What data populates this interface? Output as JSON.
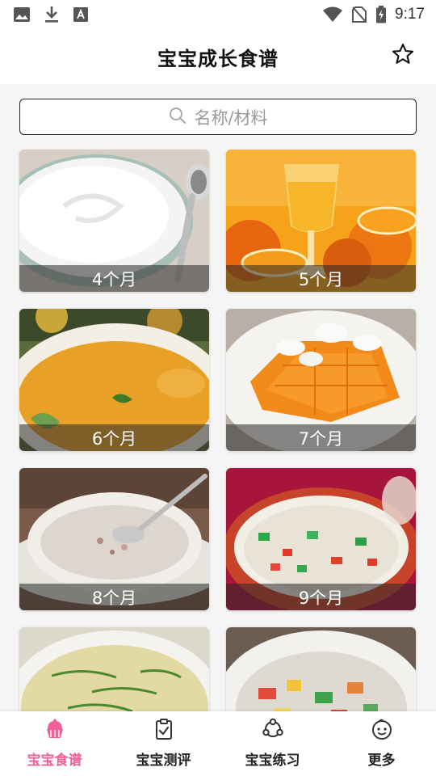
{
  "status_bar": {
    "time": "9:17",
    "left_icons": [
      "image-icon",
      "download-icon",
      "font-icon"
    ],
    "right_icons": [
      "wifi-icon",
      "no-sim-icon",
      "battery-charging-icon"
    ]
  },
  "header": {
    "title": "宝宝成长食谱",
    "favorite_icon": "star-outline-icon"
  },
  "search": {
    "placeholder": "名称/材料",
    "icon": "search-icon"
  },
  "recipe_cards": [
    {
      "label": "4个月",
      "photo": "yogurt-bowl"
    },
    {
      "label": "5个月",
      "photo": "orange-juice"
    },
    {
      "label": "6个月",
      "photo": "pumpkin-soup"
    },
    {
      "label": "7个月",
      "photo": "papaya-plate"
    },
    {
      "label": "8个月",
      "photo": "white-porridge"
    },
    {
      "label": "9个月",
      "photo": "vegetable-congee"
    },
    {
      "label": "",
      "photo": "millet-porridge"
    },
    {
      "label": "",
      "photo": "mixed-vegetables"
    }
  ],
  "bottom_nav": {
    "items": [
      {
        "label": "宝宝食谱",
        "icon": "cupcake-icon",
        "active": true
      },
      {
        "label": "宝宝测评",
        "icon": "clipboard-check-icon",
        "active": false
      },
      {
        "label": "宝宝练习",
        "icon": "orbit-icon",
        "active": false
      },
      {
        "label": "更多",
        "icon": "baby-face-icon",
        "active": false
      }
    ]
  },
  "colors": {
    "accent": "#f0609a",
    "background": "#f5f5f5",
    "label_overlay": "#282828"
  }
}
